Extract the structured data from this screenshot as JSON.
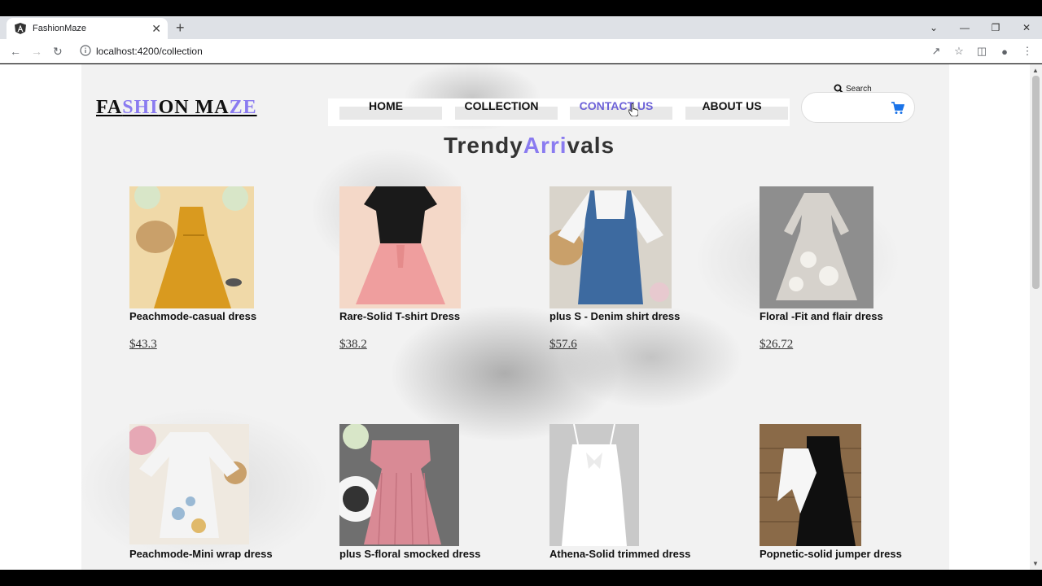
{
  "browser": {
    "tab_title": "FashionMaze",
    "url": "localhost:4200/collection",
    "new_tab_symbol": "+",
    "tab_close_symbol": "✕",
    "window_controls": [
      "⌄",
      "—",
      "❐",
      "✕"
    ]
  },
  "site": {
    "logo_parts": [
      {
        "text": "FA",
        "accent": false
      },
      {
        "text": "SHI",
        "accent": true
      },
      {
        "text": "ON MA",
        "accent": false
      },
      {
        "text": "ZE",
        "accent": true
      }
    ],
    "nav": [
      {
        "label": "HOME",
        "active": false
      },
      {
        "label": "COLLECTION",
        "active": false
      },
      {
        "label": "CONTACT US",
        "active": true
      },
      {
        "label": "ABOUT US",
        "active": false
      }
    ],
    "search_label": "Search",
    "search_value": "",
    "heading": {
      "part1": "Trendy",
      "part2": "Arri",
      "part3": "vals"
    }
  },
  "products": [
    {
      "name": "Peachmode-casual dress",
      "price": "$43.3",
      "colors": [
        "#d99a1f",
        "#f0d9a8"
      ]
    },
    {
      "name": "Rare-Solid T-shirt Dress",
      "price": "$38.2",
      "colors": [
        "#1a1a1a",
        "#ef9e9e"
      ]
    },
    {
      "name": "plus S - Denim shirt dress",
      "price": "$57.6",
      "colors": [
        "#f5f5f5",
        "#3d6aa0"
      ]
    },
    {
      "name": "Floral -Fit and flair dress",
      "price": "$26.72",
      "colors": [
        "#8e8e8e",
        "#d6d2cc"
      ]
    },
    {
      "name": "Peachmode-Mini wrap dress",
      "price": "",
      "colors": [
        "#f4f4f4",
        "#9ab9d4"
      ]
    },
    {
      "name": "plus S-floral smocked dress",
      "price": "",
      "colors": [
        "#d98a95",
        "#6f6f6f"
      ]
    },
    {
      "name": "Athena-Solid trimmed dress",
      "price": "",
      "colors": [
        "#ffffff",
        "#c9c9c9"
      ]
    },
    {
      "name": "Popnetic-solid jumper dress",
      "price": "",
      "colors": [
        "#0f0f0f",
        "#8a6a48"
      ]
    }
  ],
  "colors": {
    "accent": "#8a7bf0",
    "active_nav": "#6d62d8",
    "cart": "#1a73e8"
  }
}
